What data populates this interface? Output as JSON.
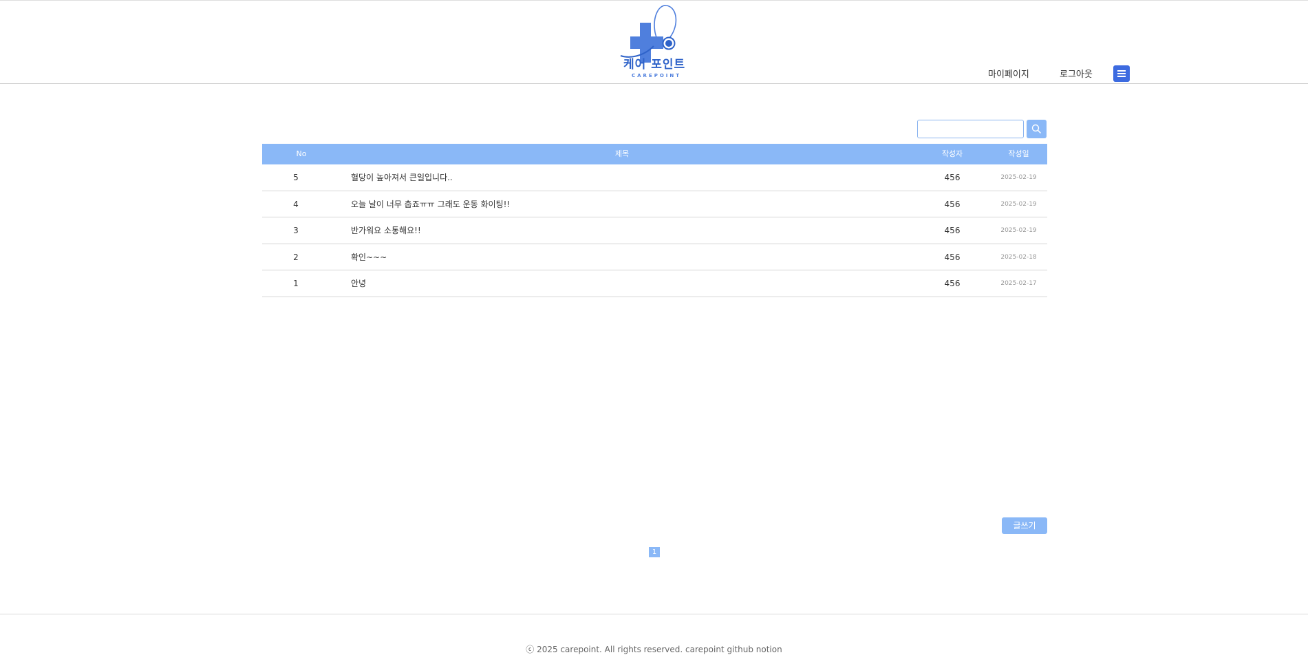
{
  "header": {
    "logo": {
      "text_ko": "케어 포인트",
      "text_en": "CAREPOINT",
      "icon": "carepoint-logo-icon",
      "brand_color": "#2f63c9"
    },
    "nav": {
      "mypage": "마이페이지",
      "logout": "로그아웃"
    },
    "menu_icon": "hamburger-menu-icon",
    "menu_color": "#3d6be0"
  },
  "search": {
    "value": "",
    "placeholder": "",
    "icon": "search-icon"
  },
  "board": {
    "columns": {
      "no": "No",
      "title": "제목",
      "author": "작성자",
      "date": "작성일"
    },
    "header_color": "#8ab8f7",
    "rows": [
      {
        "no": "5",
        "title": "혈당이 높아져서 큰일입니다..",
        "author": "456",
        "date": "2025-02-19"
      },
      {
        "no": "4",
        "title": "오늘 날이 너무 춥죠ㅠㅠ 그래도 운동 화이팅!!",
        "author": "456",
        "date": "2025-02-19"
      },
      {
        "no": "3",
        "title": "반가워요 소통해요!!",
        "author": "456",
        "date": "2025-02-19"
      },
      {
        "no": "2",
        "title": "확인~~~",
        "author": "456",
        "date": "2025-02-18"
      },
      {
        "no": "1",
        "title": "안녕",
        "author": "456",
        "date": "2025-02-17"
      }
    ]
  },
  "write_button": "글쓰기",
  "pagination": {
    "current": "1"
  },
  "footer": {
    "copyright": "ⓒ 2025 carepoint. All rights reserved.",
    "links": [
      "carepoint",
      "github",
      "notion"
    ]
  }
}
